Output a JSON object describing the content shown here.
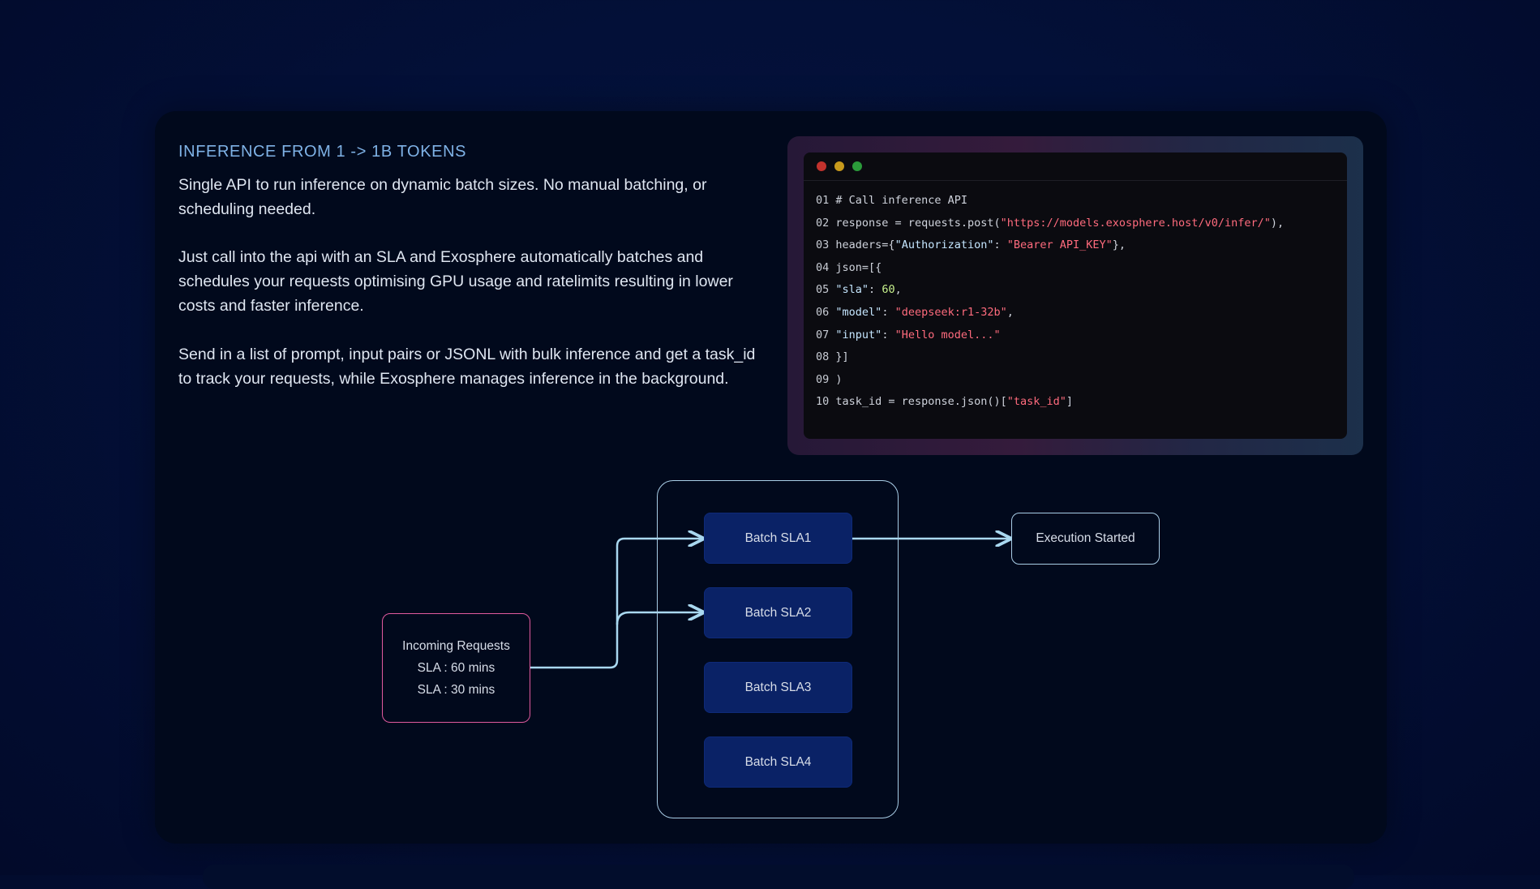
{
  "section": {
    "eyebrow": "INFERENCE FROM 1 -> 1B TOKENS",
    "paragraphs": [
      "Single API to run inference on dynamic batch sizes. No manual batching, or scheduling needed.",
      "Just call into the api with an SLA and Exosphere automatically batches and schedules your requests optimising GPU usage and ratelimits resulting in lower costs and faster inference.",
      "Send in a list of prompt, input pairs or JSONL with bulk inference and get a task_id to track your requests, while Exosphere manages inference in the background."
    ]
  },
  "code": {
    "lines": [
      {
        "n": "01",
        "tokens": [
          {
            "t": "# Call inference API",
            "c": "plain"
          }
        ]
      },
      {
        "n": "02",
        "tokens": [
          {
            "t": "response = requests.post(",
            "c": "plain"
          },
          {
            "t": "\"https://models.exosphere.host/v0/infer/\"",
            "c": "str"
          },
          {
            "t": "),",
            "c": "plain"
          }
        ]
      },
      {
        "n": "03",
        "tokens": [
          {
            "t": "headers={",
            "c": "plain"
          },
          {
            "t": "\"Authorization\"",
            "c": "key"
          },
          {
            "t": ": ",
            "c": "plain"
          },
          {
            "t": "\"Bearer API_KEY\"",
            "c": "str"
          },
          {
            "t": "},",
            "c": "plain"
          }
        ]
      },
      {
        "n": "04",
        "tokens": [
          {
            "t": "json=[{",
            "c": "plain"
          }
        ]
      },
      {
        "n": "05",
        "tokens": [
          {
            "t": "\"sla\"",
            "c": "key"
          },
          {
            "t": ": ",
            "c": "plain"
          },
          {
            "t": "60",
            "c": "num"
          },
          {
            "t": ",",
            "c": "plain"
          }
        ]
      },
      {
        "n": "06",
        "tokens": [
          {
            "t": "\"model\"",
            "c": "key"
          },
          {
            "t": ": ",
            "c": "plain"
          },
          {
            "t": "\"deepseek:r1-32b\"",
            "c": "str"
          },
          {
            "t": ",",
            "c": "plain"
          }
        ]
      },
      {
        "n": "07",
        "tokens": [
          {
            "t": "\"input\"",
            "c": "key"
          },
          {
            "t": ": ",
            "c": "plain"
          },
          {
            "t": "\"Hello model...\"",
            "c": "str"
          }
        ]
      },
      {
        "n": "08",
        "tokens": [
          {
            "t": "}]",
            "c": "plain"
          }
        ]
      },
      {
        "n": "09",
        "tokens": [
          {
            "t": ")",
            "c": "plain"
          }
        ]
      },
      {
        "n": "10",
        "tokens": [
          {
            "t": "task_id = response.json()[",
            "c": "plain"
          },
          {
            "t": "\"task_id\"",
            "c": "str"
          },
          {
            "t": "]",
            "c": "plain"
          }
        ]
      }
    ]
  },
  "diagram": {
    "incoming": {
      "title": "Incoming Requests",
      "lines": [
        "SLA : 60 mins",
        "SLA : 30 mins"
      ]
    },
    "batches": [
      "Batch SLA1",
      "Batch SLA2",
      "Batch SLA3",
      "Batch SLA4"
    ],
    "output": "Execution Started"
  },
  "colors": {
    "background": "#031038",
    "card": "#01091c",
    "eyebrow": "#7fb2e6",
    "batch_fill": "#0a2266",
    "connector": "#a9d8f0",
    "incoming_border": "#e05a9e",
    "string": "#ff6b7d",
    "number": "#c6f08c"
  }
}
